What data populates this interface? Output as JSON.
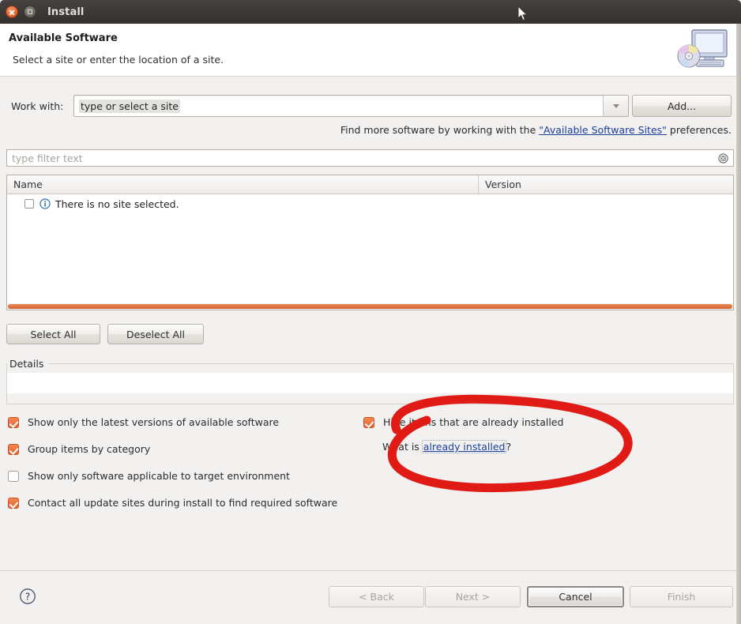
{
  "window": {
    "title": "Install",
    "close_icon": "close-icon",
    "maximize_icon": "maximize-icon"
  },
  "banner": {
    "title": "Available Software",
    "subtitle": "Select a site or enter the location of a site.",
    "icon": "install-computer-disc-icon"
  },
  "work_with": {
    "label": "Work with:",
    "value": "type or select a site",
    "placeholder": "type or select a site",
    "dropdown_icon": "chevron-down-icon",
    "add_button": "Add..."
  },
  "find_more": {
    "prefix": "Find more software by working with the ",
    "link": "\"Available Software Sites\"",
    "suffix": " preferences."
  },
  "filter": {
    "placeholder": "type filter text",
    "value": "",
    "clear_icon": "clear-icon"
  },
  "table": {
    "columns": [
      "Name",
      "Version"
    ],
    "rows": [
      {
        "checked": false,
        "icon": "info-icon",
        "name": "There is no site selected.",
        "version": ""
      }
    ],
    "scrollbar_color": "#dd7140"
  },
  "selection_buttons": {
    "select_all": "Select All",
    "deselect_all": "Deselect All"
  },
  "details": {
    "label": "Details",
    "content": ""
  },
  "options": [
    {
      "label": "Show only the latest versions of available software",
      "checked": true
    },
    {
      "label": "Group items by category",
      "checked": true
    },
    {
      "label": "Show only software applicable to target environment",
      "checked": false
    },
    {
      "label": "Contact all update sites during install to find required software",
      "checked": true
    },
    {
      "label": "Hide items that are already installed",
      "checked": true
    }
  ],
  "what_is": {
    "prefix": "What is ",
    "link": "already installed",
    "suffix": "?"
  },
  "footer": {
    "help_icon": "help-icon",
    "buttons": [
      {
        "label": "< Back",
        "enabled": false
      },
      {
        "label": "Next >",
        "enabled": false
      },
      {
        "label": "Cancel",
        "enabled": true
      },
      {
        "label": "Finish",
        "enabled": false
      }
    ]
  },
  "annotation": {
    "shape": "red-ellipse-highlight",
    "color": "#e01b15"
  },
  "colors": {
    "accent_orange": "#e3673a",
    "link_blue": "#1a3f99",
    "titlebar": "#3c3835"
  }
}
